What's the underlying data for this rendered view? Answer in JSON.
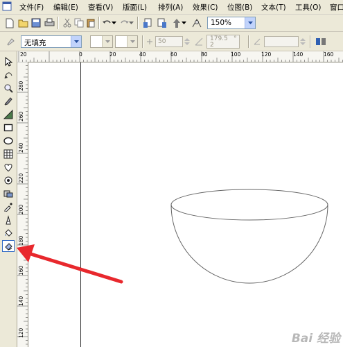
{
  "menu": {
    "items": [
      {
        "label": "文件(F)"
      },
      {
        "label": "编辑(E)"
      },
      {
        "label": "查看(V)"
      },
      {
        "label": "版面(L)"
      },
      {
        "label": "排列(A)"
      },
      {
        "label": "效果(C)"
      },
      {
        "label": "位图(B)"
      },
      {
        "label": "文本(T)"
      },
      {
        "label": "工具(O)"
      },
      {
        "label": "窗口"
      }
    ]
  },
  "toolbar": {
    "zoom_value": "150%"
  },
  "property_bar": {
    "fill_value": "无填充",
    "transparency_value": "50",
    "angle_value": "179.5",
    "degree_unit": "°",
    "count_value": "2"
  },
  "rulers": {
    "horizontal_ticks": [
      "20",
      "0",
      "20",
      "40",
      "60",
      "80",
      "100",
      "120",
      "140",
      "160"
    ],
    "vertical_ticks": [
      "280",
      "260",
      "240",
      "220",
      "200",
      "180",
      "160",
      "140",
      "120"
    ]
  },
  "watermark": "Bai  经验",
  "colors": {
    "ui_background": "#ece9d8",
    "canvas": "#ffffff",
    "arrow": "#e8282d",
    "combo_border": "#7f9db9"
  }
}
